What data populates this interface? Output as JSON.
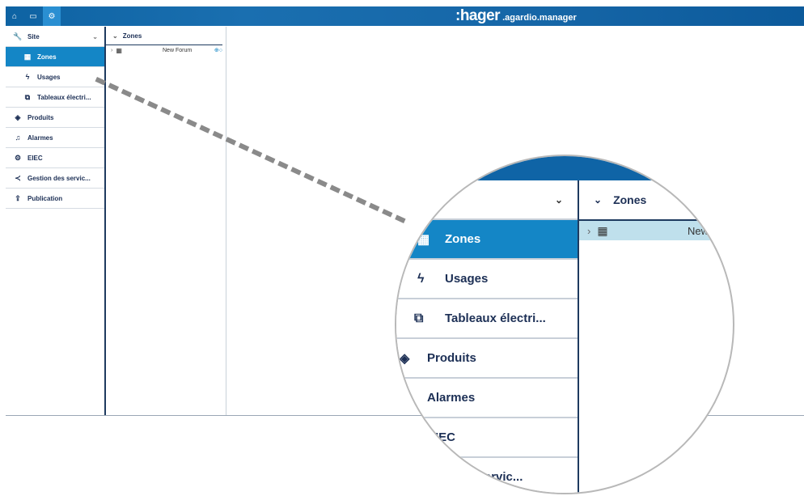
{
  "header": {
    "brand_main": ":hager",
    "brand_sub": ".agardio.manager",
    "buttons": [
      {
        "name": "home-icon",
        "glyph": "⌂"
      },
      {
        "name": "laptop-icon",
        "glyph": "▭"
      },
      {
        "name": "settings-icon",
        "glyph": "⚙"
      }
    ]
  },
  "sidebar": {
    "items": [
      {
        "label": "Site",
        "icon": "wrench-icon",
        "glyph": "🔧"
      },
      {
        "label": "Zones",
        "icon": "building-icon",
        "glyph": "▦"
      },
      {
        "label": "Usages",
        "icon": "lightning-icon",
        "glyph": "ϟ"
      },
      {
        "label": "Tableaux électri...",
        "icon": "panel-icon",
        "glyph": "⧉"
      },
      {
        "label": "Produits",
        "icon": "box-icon",
        "glyph": "◈"
      },
      {
        "label": "Alarmes",
        "icon": "bell-icon",
        "glyph": "🔔"
      },
      {
        "label": "EIEC",
        "icon": "gears-icon",
        "glyph": "⚙"
      },
      {
        "label": "Gestion des servic...",
        "icon": "share-icon",
        "glyph": "⋖"
      },
      {
        "label": "Publication",
        "icon": "upload-icon",
        "glyph": "⇪"
      }
    ]
  },
  "zones_panel": {
    "title": "Zones",
    "rows": [
      {
        "name": "New Forum"
      }
    ]
  },
  "zoom": {
    "items": [
      "Zones",
      "Usages",
      "Tableaux électri...",
      "Produits",
      "Alarmes",
      "EIEC",
      "s servic..."
    ],
    "head": "Zones",
    "row": "New"
  },
  "colors": {
    "topbar": "#0f64a6",
    "active": "#1486c6",
    "navy": "#1c2f55"
  }
}
